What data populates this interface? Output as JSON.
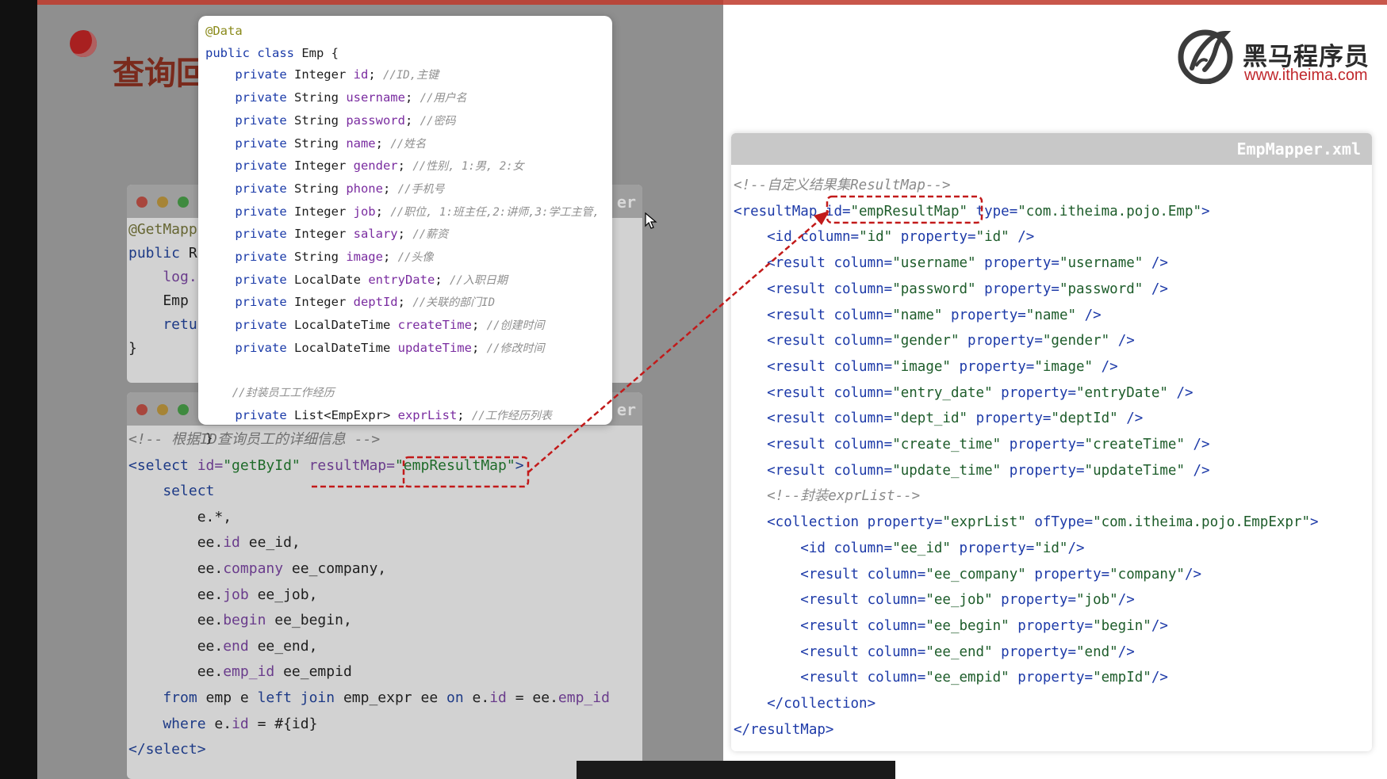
{
  "slide": {
    "heading": "查询回显"
  },
  "brand": {
    "name_cn": "黑马程序员",
    "url": "www.itheima.com"
  },
  "popup": {
    "lines": [
      [
        {
          "t": "@Data",
          "c": "an2"
        }
      ],
      [
        {
          "t": "public class ",
          "c": "kw"
        },
        {
          "t": "Emp {",
          "c": ""
        }
      ],
      [
        {
          "t": "    private ",
          "c": "kw"
        },
        {
          "t": "Integer ",
          "c": ""
        },
        {
          "t": "id",
          "c": "fld"
        },
        {
          "t": "; ",
          "c": ""
        },
        {
          "t": "//ID,主键",
          "c": "cm"
        }
      ],
      [
        {
          "t": "    private ",
          "c": "kw"
        },
        {
          "t": "String ",
          "c": ""
        },
        {
          "t": "username",
          "c": "fld"
        },
        {
          "t": "; ",
          "c": ""
        },
        {
          "t": "//用户名",
          "c": "cm"
        }
      ],
      [
        {
          "t": "    private ",
          "c": "kw"
        },
        {
          "t": "String ",
          "c": ""
        },
        {
          "t": "password",
          "c": "fld"
        },
        {
          "t": "; ",
          "c": ""
        },
        {
          "t": "//密码",
          "c": "cm"
        }
      ],
      [
        {
          "t": "    private ",
          "c": "kw"
        },
        {
          "t": "String ",
          "c": ""
        },
        {
          "t": "name",
          "c": "fld"
        },
        {
          "t": "; ",
          "c": ""
        },
        {
          "t": "//姓名",
          "c": "cm"
        }
      ],
      [
        {
          "t": "    private ",
          "c": "kw"
        },
        {
          "t": "Integer ",
          "c": ""
        },
        {
          "t": "gender",
          "c": "fld"
        },
        {
          "t": "; ",
          "c": ""
        },
        {
          "t": "//性别, 1:男, 2:女",
          "c": "cm"
        }
      ],
      [
        {
          "t": "    private ",
          "c": "kw"
        },
        {
          "t": "String ",
          "c": ""
        },
        {
          "t": "phone",
          "c": "fld"
        },
        {
          "t": "; ",
          "c": ""
        },
        {
          "t": "//手机号",
          "c": "cm"
        }
      ],
      [
        {
          "t": "    private ",
          "c": "kw"
        },
        {
          "t": "Integer ",
          "c": ""
        },
        {
          "t": "job",
          "c": "fld"
        },
        {
          "t": "; ",
          "c": ""
        },
        {
          "t": "//职位, 1:班主任,2:讲师,3:学工主管,",
          "c": "cm"
        }
      ],
      [
        {
          "t": "    private ",
          "c": "kw"
        },
        {
          "t": "Integer ",
          "c": ""
        },
        {
          "t": "salary",
          "c": "fld"
        },
        {
          "t": "; ",
          "c": ""
        },
        {
          "t": "//薪资",
          "c": "cm"
        }
      ],
      [
        {
          "t": "    private ",
          "c": "kw"
        },
        {
          "t": "String ",
          "c": ""
        },
        {
          "t": "image",
          "c": "fld"
        },
        {
          "t": "; ",
          "c": ""
        },
        {
          "t": "//头像",
          "c": "cm"
        }
      ],
      [
        {
          "t": "    private ",
          "c": "kw"
        },
        {
          "t": "LocalDate ",
          "c": ""
        },
        {
          "t": "entryDate",
          "c": "fld"
        },
        {
          "t": "; ",
          "c": ""
        },
        {
          "t": "//入职日期",
          "c": "cm"
        }
      ],
      [
        {
          "t": "    private ",
          "c": "kw"
        },
        {
          "t": "Integer ",
          "c": ""
        },
        {
          "t": "deptId",
          "c": "fld"
        },
        {
          "t": "; ",
          "c": ""
        },
        {
          "t": "//关联的部门ID",
          "c": "cm"
        }
      ],
      [
        {
          "t": "    private ",
          "c": "kw"
        },
        {
          "t": "LocalDateTime ",
          "c": ""
        },
        {
          "t": "createTime",
          "c": "fld"
        },
        {
          "t": "; ",
          "c": ""
        },
        {
          "t": "//创建时间",
          "c": "cm"
        }
      ],
      [
        {
          "t": "    private ",
          "c": "kw"
        },
        {
          "t": "LocalDateTime ",
          "c": ""
        },
        {
          "t": "updateTime",
          "c": "fld"
        },
        {
          "t": "; ",
          "c": ""
        },
        {
          "t": "//修改时间",
          "c": "cm"
        }
      ],
      [
        {
          "t": "",
          "c": ""
        }
      ],
      [
        {
          "t": "    //封装员工工作经历",
          "c": "cm"
        }
      ],
      [
        {
          "t": "    private ",
          "c": "kw"
        },
        {
          "t": "List<EmpExpr> ",
          "c": ""
        },
        {
          "t": "exprList",
          "c": "fld"
        },
        {
          "t": "; ",
          "c": ""
        },
        {
          "t": "//工作经历列表",
          "c": "cm"
        }
      ],
      [
        {
          "t": "}",
          "c": ""
        }
      ]
    ]
  },
  "mapper_window": {
    "title_partial": "er",
    "lines": [
      [
        {
          "t": "@GetMapp",
          "c": "an"
        }
      ],
      [
        {
          "t": "public ",
          "c": "kw"
        },
        {
          "t": "R",
          "c": ""
        }
      ],
      [
        {
          "t": "    log.",
          "c": "pp"
        }
      ],
      [
        {
          "t": "    Emp ",
          "c": ""
        }
      ],
      [
        {
          "t": "    retu",
          "c": "kw"
        }
      ],
      [
        {
          "t": "}",
          "c": ""
        }
      ]
    ]
  },
  "sql_window": {
    "title_partial": "er",
    "lines": [
      [
        {
          "t": "<!-- 根据ID查询员工的详细信息 -->",
          "c": "cm"
        }
      ],
      [
        {
          "t": "<select ",
          "c": "kw"
        },
        {
          "t": "id=",
          "c": "pp"
        },
        {
          "t": "\"getById\" ",
          "c": "st"
        },
        {
          "t": "resultMap=",
          "c": "pp"
        },
        {
          "t": "\"empResultMap\"",
          "c": "st"
        },
        {
          "t": ">",
          "c": "kw"
        }
      ],
      [
        {
          "t": "    select",
          "c": "kw"
        }
      ],
      [
        {
          "t": "        e.*,",
          "c": ""
        }
      ],
      [
        {
          "t": "        ee.",
          "c": ""
        },
        {
          "t": "id",
          "c": "pp"
        },
        {
          "t": " ee_id,",
          "c": ""
        }
      ],
      [
        {
          "t": "        ee.",
          "c": ""
        },
        {
          "t": "company",
          "c": "pp"
        },
        {
          "t": " ee_company,",
          "c": ""
        }
      ],
      [
        {
          "t": "        ee.",
          "c": ""
        },
        {
          "t": "job",
          "c": "pp"
        },
        {
          "t": " ee_job,",
          "c": ""
        }
      ],
      [
        {
          "t": "        ee.",
          "c": ""
        },
        {
          "t": "begin",
          "c": "pp"
        },
        {
          "t": " ee_begin,",
          "c": ""
        }
      ],
      [
        {
          "t": "        ee.",
          "c": ""
        },
        {
          "t": "end",
          "c": "pp"
        },
        {
          "t": " ee_end,",
          "c": ""
        }
      ],
      [
        {
          "t": "        ee.",
          "c": ""
        },
        {
          "t": "emp_id",
          "c": "pp"
        },
        {
          "t": " ee_empid",
          "c": ""
        }
      ],
      [
        {
          "t": "    from ",
          "c": "kw"
        },
        {
          "t": "emp e ",
          "c": ""
        },
        {
          "t": "left join ",
          "c": "kw"
        },
        {
          "t": "emp_expr ee ",
          "c": ""
        },
        {
          "t": "on ",
          "c": "kw"
        },
        {
          "t": "e.",
          "c": ""
        },
        {
          "t": "id",
          "c": "pp"
        },
        {
          "t": " = ee.",
          "c": ""
        },
        {
          "t": "emp_id",
          "c": "pp"
        }
      ],
      [
        {
          "t": "    where ",
          "c": "kw"
        },
        {
          "t": "e.",
          "c": ""
        },
        {
          "t": "id",
          "c": "pp"
        },
        {
          "t": " = #{id}",
          "c": ""
        }
      ],
      [
        {
          "t": "</select>",
          "c": "kw"
        }
      ]
    ]
  },
  "xml_window": {
    "title": "EmpMapper.xml",
    "lines": [
      [
        {
          "t": "<!--自定义结果集ResultMap-->",
          "c": "cm"
        }
      ],
      [
        {
          "t": "<resultMap ",
          "c": "kw"
        },
        {
          "t": "id=",
          "c": "pp"
        },
        {
          "t": "\"empResultMap\" ",
          "c": "st"
        },
        {
          "t": "type=",
          "c": "pp"
        },
        {
          "t": "\"com.itheima.pojo.Emp\"",
          "c": "st"
        },
        {
          "t": ">",
          "c": "kw"
        }
      ],
      [
        {
          "t": "    <id ",
          "c": "kw"
        },
        {
          "t": "column=",
          "c": "pp"
        },
        {
          "t": "\"id\" ",
          "c": "st"
        },
        {
          "t": "property=",
          "c": "pp"
        },
        {
          "t": "\"id\" ",
          "c": "st"
        },
        {
          "t": "/>",
          "c": "kw"
        }
      ],
      [
        {
          "t": "    <result ",
          "c": "kw"
        },
        {
          "t": "column=",
          "c": "pp"
        },
        {
          "t": "\"username\" ",
          "c": "st"
        },
        {
          "t": "property=",
          "c": "pp"
        },
        {
          "t": "\"username\" ",
          "c": "st"
        },
        {
          "t": "/>",
          "c": "kw"
        }
      ],
      [
        {
          "t": "    <result ",
          "c": "kw"
        },
        {
          "t": "column=",
          "c": "pp"
        },
        {
          "t": "\"password\" ",
          "c": "st"
        },
        {
          "t": "property=",
          "c": "pp"
        },
        {
          "t": "\"password\" ",
          "c": "st"
        },
        {
          "t": "/>",
          "c": "kw"
        }
      ],
      [
        {
          "t": "    <result ",
          "c": "kw"
        },
        {
          "t": "column=",
          "c": "pp"
        },
        {
          "t": "\"name\" ",
          "c": "st"
        },
        {
          "t": "property=",
          "c": "pp"
        },
        {
          "t": "\"name\" ",
          "c": "st"
        },
        {
          "t": "/>",
          "c": "kw"
        }
      ],
      [
        {
          "t": "    <result ",
          "c": "kw"
        },
        {
          "t": "column=",
          "c": "pp"
        },
        {
          "t": "\"gender\" ",
          "c": "st"
        },
        {
          "t": "property=",
          "c": "pp"
        },
        {
          "t": "\"gender\" ",
          "c": "st"
        },
        {
          "t": "/>",
          "c": "kw"
        }
      ],
      [
        {
          "t": "    <result ",
          "c": "kw"
        },
        {
          "t": "column=",
          "c": "pp"
        },
        {
          "t": "\"image\" ",
          "c": "st"
        },
        {
          "t": "property=",
          "c": "pp"
        },
        {
          "t": "\"image\" ",
          "c": "st"
        },
        {
          "t": "/>",
          "c": "kw"
        }
      ],
      [
        {
          "t": "    <result ",
          "c": "kw"
        },
        {
          "t": "column=",
          "c": "pp"
        },
        {
          "t": "\"entry_date\" ",
          "c": "st"
        },
        {
          "t": "property=",
          "c": "pp"
        },
        {
          "t": "\"entryDate\" ",
          "c": "st"
        },
        {
          "t": "/>",
          "c": "kw"
        }
      ],
      [
        {
          "t": "    <result ",
          "c": "kw"
        },
        {
          "t": "column=",
          "c": "pp"
        },
        {
          "t": "\"dept_id\" ",
          "c": "st"
        },
        {
          "t": "property=",
          "c": "pp"
        },
        {
          "t": "\"deptId\" ",
          "c": "st"
        },
        {
          "t": "/>",
          "c": "kw"
        }
      ],
      [
        {
          "t": "    <result ",
          "c": "kw"
        },
        {
          "t": "column=",
          "c": "pp"
        },
        {
          "t": "\"create_time\" ",
          "c": "st"
        },
        {
          "t": "property=",
          "c": "pp"
        },
        {
          "t": "\"createTime\" ",
          "c": "st"
        },
        {
          "t": "/>",
          "c": "kw"
        }
      ],
      [
        {
          "t": "    <result ",
          "c": "kw"
        },
        {
          "t": "column=",
          "c": "pp"
        },
        {
          "t": "\"update_time\" ",
          "c": "st"
        },
        {
          "t": "property=",
          "c": "pp"
        },
        {
          "t": "\"updateTime\" ",
          "c": "st"
        },
        {
          "t": "/>",
          "c": "kw"
        }
      ],
      [
        {
          "t": "    <!--封装exprList-->",
          "c": "cm"
        }
      ],
      [
        {
          "t": "    <collection ",
          "c": "kw"
        },
        {
          "t": "property=",
          "c": "pp"
        },
        {
          "t": "\"exprList\" ",
          "c": "st"
        },
        {
          "t": "ofType=",
          "c": "pp"
        },
        {
          "t": "\"com.itheima.pojo.EmpExpr\"",
          "c": "st"
        },
        {
          "t": ">",
          "c": "kw"
        }
      ],
      [
        {
          "t": "        <id ",
          "c": "kw"
        },
        {
          "t": "column=",
          "c": "pp"
        },
        {
          "t": "\"ee_id\" ",
          "c": "st"
        },
        {
          "t": "property=",
          "c": "pp"
        },
        {
          "t": "\"id\"",
          "c": "st"
        },
        {
          "t": "/>",
          "c": "kw"
        }
      ],
      [
        {
          "t": "        <result ",
          "c": "kw"
        },
        {
          "t": "column=",
          "c": "pp"
        },
        {
          "t": "\"ee_company\" ",
          "c": "st"
        },
        {
          "t": "property=",
          "c": "pp"
        },
        {
          "t": "\"company\"",
          "c": "st"
        },
        {
          "t": "/>",
          "c": "kw"
        }
      ],
      [
        {
          "t": "        <result ",
          "c": "kw"
        },
        {
          "t": "column=",
          "c": "pp"
        },
        {
          "t": "\"ee_job\" ",
          "c": "st"
        },
        {
          "t": "property=",
          "c": "pp"
        },
        {
          "t": "\"job\"",
          "c": "st"
        },
        {
          "t": "/>",
          "c": "kw"
        }
      ],
      [
        {
          "t": "        <result ",
          "c": "kw"
        },
        {
          "t": "column=",
          "c": "pp"
        },
        {
          "t": "\"ee_begin\" ",
          "c": "st"
        },
        {
          "t": "property=",
          "c": "pp"
        },
        {
          "t": "\"begin\"",
          "c": "st"
        },
        {
          "t": "/>",
          "c": "kw"
        }
      ],
      [
        {
          "t": "        <result ",
          "c": "kw"
        },
        {
          "t": "column=",
          "c": "pp"
        },
        {
          "t": "\"ee_end\" ",
          "c": "st"
        },
        {
          "t": "property=",
          "c": "pp"
        },
        {
          "t": "\"end\"",
          "c": "st"
        },
        {
          "t": "/>",
          "c": "kw"
        }
      ],
      [
        {
          "t": "        <result ",
          "c": "kw"
        },
        {
          "t": "column=",
          "c": "pp"
        },
        {
          "t": "\"ee_empid\" ",
          "c": "st"
        },
        {
          "t": "property=",
          "c": "pp"
        },
        {
          "t": "\"empId\"",
          "c": "st"
        },
        {
          "t": "/>",
          "c": "kw"
        }
      ],
      [
        {
          "t": "    </collection>",
          "c": "kw"
        }
      ],
      [
        {
          "t": "</resultMap>",
          "c": "kw"
        }
      ]
    ]
  },
  "colors": {
    "accent_red": "#c21a1a",
    "brand_red": "#c0282d",
    "dim_overlay": "#8f8f8f"
  }
}
